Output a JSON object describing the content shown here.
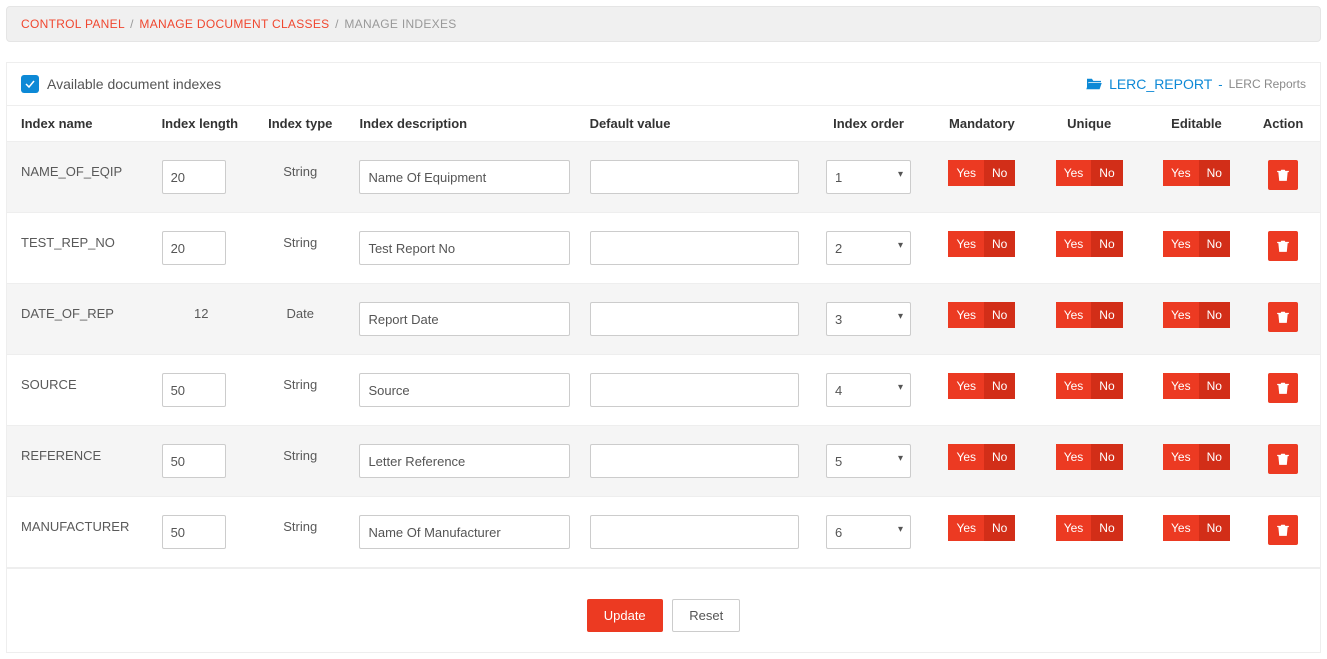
{
  "breadcrumb": {
    "items": [
      {
        "label": "CONTROL PANEL"
      },
      {
        "label": "MANAGE DOCUMENT CLASSES"
      }
    ],
    "current": "MANAGE INDEXES",
    "sep": "/"
  },
  "panel": {
    "title": "Available document indexes",
    "checked": true,
    "report_code": "LERC_REPORT",
    "report_sep": "-",
    "report_name": "LERC Reports"
  },
  "columns": {
    "name": "Index name",
    "length": "Index length",
    "type": "Index type",
    "description": "Index description",
    "default": "Default value",
    "order": "Index order",
    "mandatory": "Mandatory",
    "unique": "Unique",
    "editable": "Editable",
    "action": "Action"
  },
  "toggle": {
    "yes": "Yes",
    "no": "No"
  },
  "rows": [
    {
      "name": "NAME_OF_EQIP",
      "length": "20",
      "length_editable": true,
      "type": "String",
      "description": "Name Of Equipment",
      "default": "",
      "order": "1"
    },
    {
      "name": "TEST_REP_NO",
      "length": "20",
      "length_editable": true,
      "type": "String",
      "description": "Test Report No",
      "default": "",
      "order": "2"
    },
    {
      "name": "DATE_OF_REP",
      "length": "12",
      "length_editable": false,
      "type": "Date",
      "description": "Report Date",
      "default": "",
      "order": "3"
    },
    {
      "name": "SOURCE",
      "length": "50",
      "length_editable": true,
      "type": "String",
      "description": "Source",
      "default": "",
      "order": "4"
    },
    {
      "name": "REFERENCE",
      "length": "50",
      "length_editable": true,
      "type": "String",
      "description": "Letter Reference",
      "default": "",
      "order": "5"
    },
    {
      "name": "MANUFACTURER",
      "length": "50",
      "length_editable": true,
      "type": "String",
      "description": "Name Of Manufacturer",
      "default": "",
      "order": "6"
    }
  ],
  "buttons": {
    "update": "Update",
    "reset": "Reset"
  }
}
